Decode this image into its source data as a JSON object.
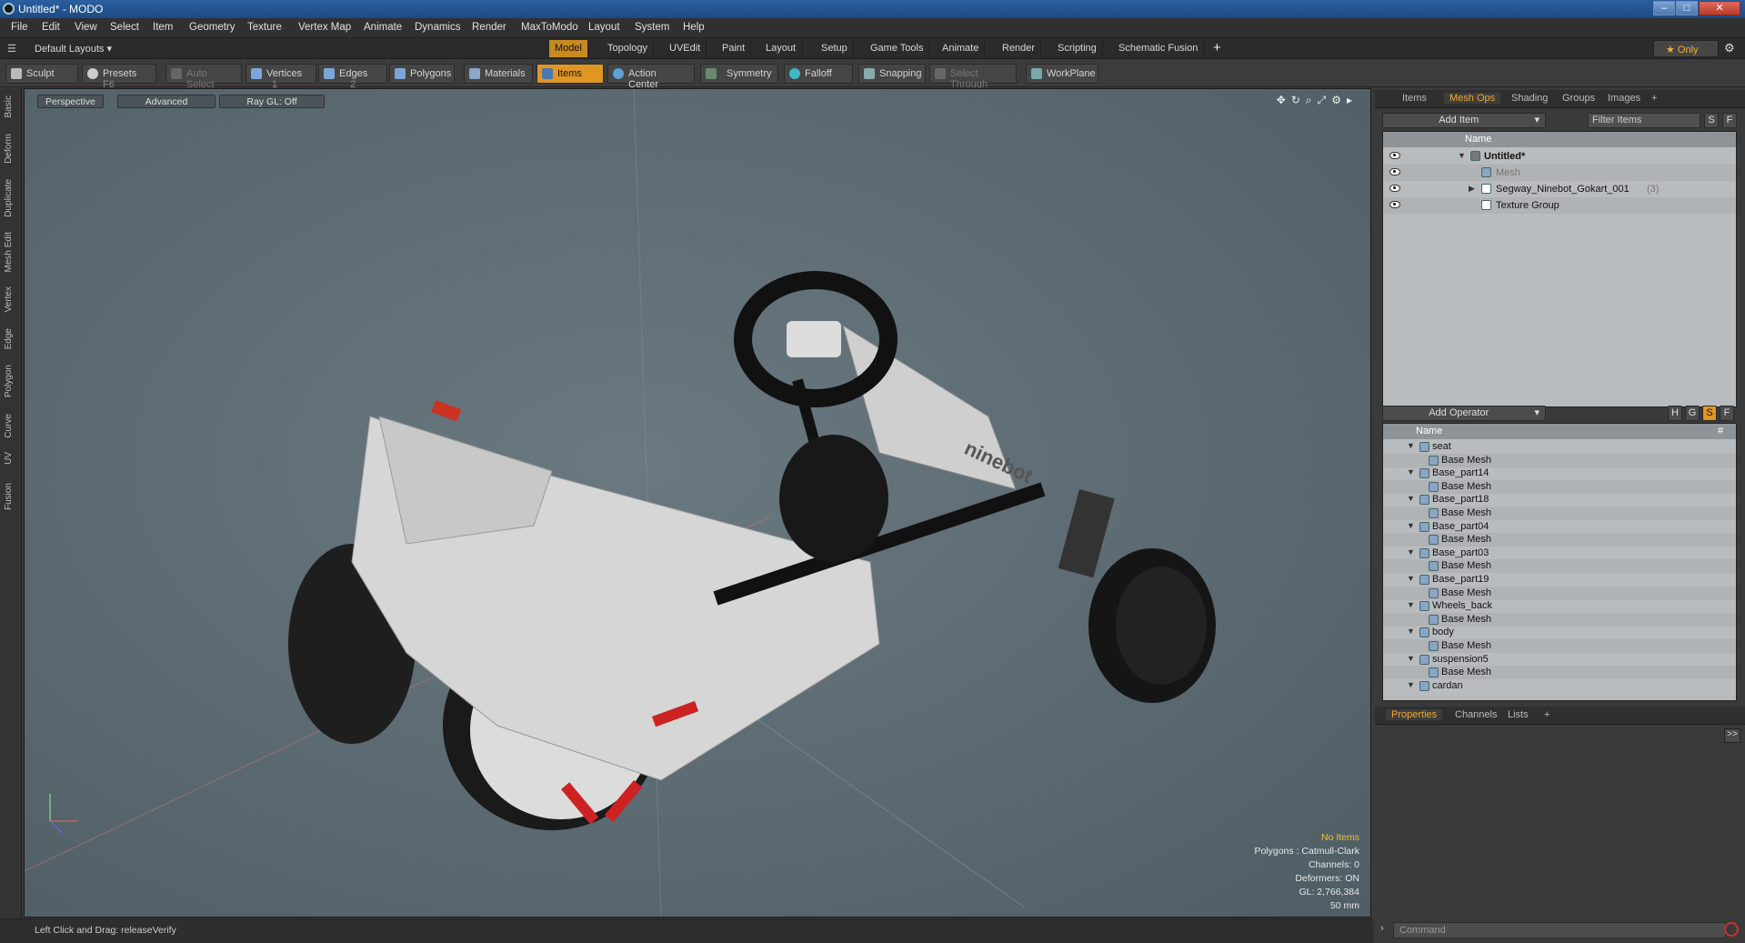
{
  "window": {
    "title": "Untitled* - MODO",
    "min": "–",
    "max": "□",
    "close": "✕"
  },
  "menu": [
    "File",
    "Edit",
    "View",
    "Select",
    "Item",
    "Geometry",
    "Texture",
    "Vertex Map",
    "Animate",
    "Dynamics",
    "Render",
    "MaxToModo",
    "Layout",
    "System",
    "Help"
  ],
  "layout_selector": "Default Layouts ▾",
  "tabs": [
    "Model",
    "Topology",
    "UVEdit",
    "Paint",
    "Layout",
    "Setup",
    "Game Tools",
    "Animate",
    "Render",
    "Scripting",
    "Schematic Fusion"
  ],
  "tab_add": "+",
  "only_label": "★  Only",
  "toolbar": {
    "sculpt": "Sculpt",
    "presets": "Presets",
    "presets_key": "F6",
    "auto_select": "Auto Select",
    "vertices": "Vertices",
    "vertices_count": "1",
    "edges": "Edges",
    "edges_count": "2",
    "polygons": "Polygons",
    "materials": "Materials",
    "items": "Items",
    "action_center": "Action Center",
    "symmetry": "Symmetry",
    "falloff": "Falloff",
    "snapping": "Snapping",
    "select_through": "Select Through",
    "workplane": "WorkPlane"
  },
  "left_strip": [
    "Basic",
    "Deform",
    "Duplicate",
    "Mesh Edit",
    "Vertex",
    "Edge",
    "Polygon",
    "Curve",
    "UV",
    "Fusion"
  ],
  "viewport": {
    "perspective": "Perspective",
    "advanced": "Advanced",
    "raygl": "Ray GL: Off",
    "info": {
      "no_items": "No Items",
      "polygons": "Polygons : Catmull-Clark",
      "channels": "Channels: 0",
      "deformers": "Deformers: ON",
      "gl": "GL: 2,766,384",
      "scale": "50 mm"
    }
  },
  "status": "Left Click and Drag:   releaseVerify",
  "items_panel": {
    "tabs": [
      "Items",
      "Mesh Ops",
      "Shading",
      "Groups",
      "Images"
    ],
    "add_tab": "+",
    "add_item": "Add Item",
    "filter": "Filter Items",
    "s_btn": "S",
    "f_btn": "F",
    "col_name": "Name",
    "rows": [
      {
        "label": "Untitled*",
        "indent": 0
      },
      {
        "label": "Mesh",
        "indent": 1
      },
      {
        "label": "Segway_Ninebot_Gokart_001",
        "count": "(3)",
        "indent": 1
      },
      {
        "label": "Texture Group",
        "indent": 1
      }
    ]
  },
  "meshops_panel": {
    "add_operator": "Add Operator",
    "btns": [
      "H",
      "G",
      "S",
      "F"
    ],
    "col_name": "Name",
    "col_hash": "#",
    "rows": [
      "seat",
      "Base Mesh",
      "Base_part14",
      "Base Mesh",
      "Base_part18",
      "Base Mesh",
      "Base_part04",
      "Base Mesh",
      "Base_part03",
      "Base Mesh",
      "Base_part19",
      "Base Mesh",
      "Wheels_back",
      "Base Mesh",
      "body",
      "Base Mesh",
      "suspension5",
      "Base Mesh",
      "cardan"
    ]
  },
  "bottom_panel": {
    "tabs": [
      "Properties",
      "Channels",
      "Lists"
    ],
    "add_tab": "+",
    "command_placeholder": "Command",
    "expand": ">>"
  },
  "colors": {
    "accent": "#e09623",
    "titlebar": "#1d4a85",
    "viewport_bg": "#5e6c73"
  }
}
